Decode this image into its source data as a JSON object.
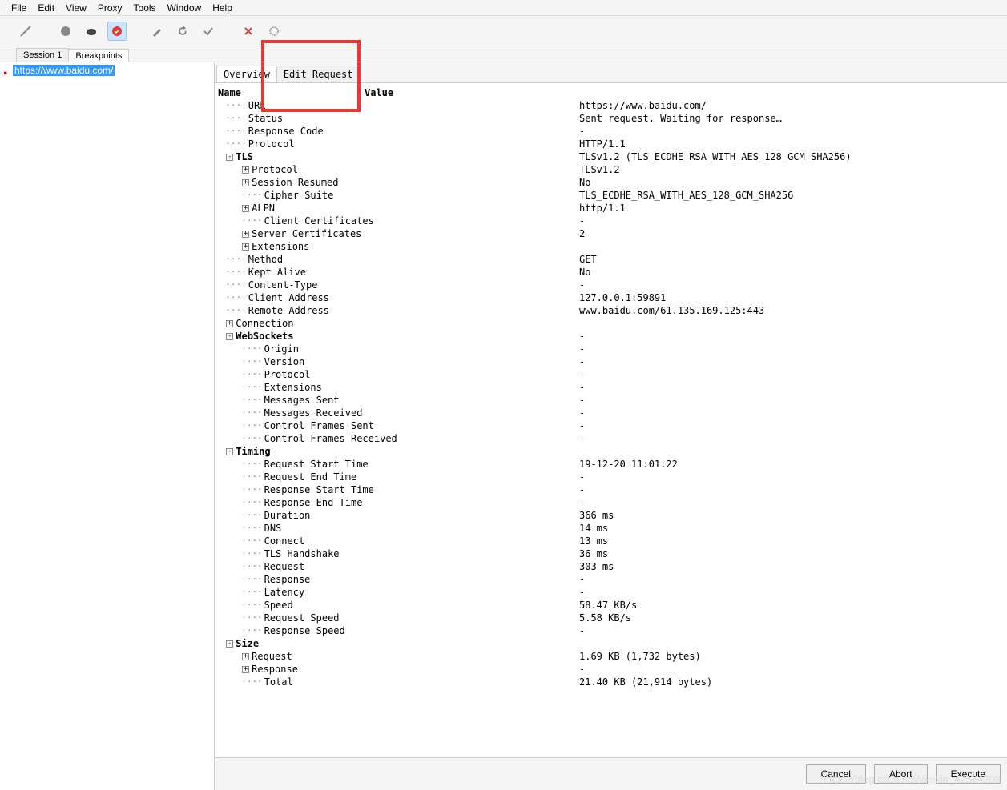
{
  "menu": {
    "file": "File",
    "edit": "Edit",
    "view": "View",
    "proxy": "Proxy",
    "tools": "Tools",
    "window": "Window",
    "help": "Help"
  },
  "sessionTabs": {
    "session1": "Session 1",
    "breakpoints": "Breakpoints"
  },
  "sidebar": {
    "item0": {
      "url": "https://www.baidu.com/"
    }
  },
  "detailTabs": {
    "overview": "Overview",
    "editRequest": "Edit Request"
  },
  "headers": {
    "name": "Name",
    "value": "Value"
  },
  "overview": {
    "url": {
      "label": "URL",
      "value": "https://www.baidu.com/"
    },
    "status": {
      "label": "Status",
      "value": "Sent request. Waiting for response…"
    },
    "responseCode": {
      "label": "Response Code",
      "value": "-"
    },
    "protocol": {
      "label": "Protocol",
      "value": "HTTP/1.1"
    },
    "tls": {
      "label": "TLS",
      "value": "TLSv1.2 (TLS_ECDHE_RSA_WITH_AES_128_GCM_SHA256)",
      "protocol": {
        "label": "Protocol",
        "value": "TLSv1.2"
      },
      "sessionResumed": {
        "label": "Session Resumed",
        "value": "No"
      },
      "cipherSuite": {
        "label": "Cipher Suite",
        "value": "TLS_ECDHE_RSA_WITH_AES_128_GCM_SHA256"
      },
      "alpn": {
        "label": "ALPN",
        "value": "http/1.1"
      },
      "clientCerts": {
        "label": "Client Certificates",
        "value": "-"
      },
      "serverCerts": {
        "label": "Server Certificates",
        "value": "2"
      },
      "extensions": {
        "label": "Extensions",
        "value": ""
      }
    },
    "method": {
      "label": "Method",
      "value": "GET"
    },
    "keptAlive": {
      "label": "Kept Alive",
      "value": "No"
    },
    "contentType": {
      "label": "Content-Type",
      "value": "-"
    },
    "clientAddress": {
      "label": "Client Address",
      "value": "127.0.0.1:59891"
    },
    "remoteAddress": {
      "label": "Remote Address",
      "value": "www.baidu.com/61.135.169.125:443"
    },
    "connection": {
      "label": "Connection",
      "value": ""
    },
    "webSockets": {
      "label": "WebSockets",
      "value": "-",
      "origin": {
        "label": "Origin",
        "value": "-"
      },
      "version": {
        "label": "Version",
        "value": "-"
      },
      "protocol": {
        "label": "Protocol",
        "value": "-"
      },
      "extensions": {
        "label": "Extensions",
        "value": "-"
      },
      "messagesSent": {
        "label": "Messages Sent",
        "value": "-"
      },
      "messagesReceived": {
        "label": "Messages Received",
        "value": "-"
      },
      "ctrlFramesSent": {
        "label": "Control Frames Sent",
        "value": "-"
      },
      "ctrlFramesRecv": {
        "label": "Control Frames Received",
        "value": "-"
      }
    },
    "timing": {
      "label": "Timing",
      "value": "",
      "reqStart": {
        "label": "Request Start Time",
        "value": "19-12-20 11:01:22"
      },
      "reqEnd": {
        "label": "Request End Time",
        "value": "-"
      },
      "respStart": {
        "label": "Response Start Time",
        "value": "-"
      },
      "respEnd": {
        "label": "Response End Time",
        "value": "-"
      },
      "duration": {
        "label": "Duration",
        "value": "366 ms"
      },
      "dns": {
        "label": "DNS",
        "value": "14 ms"
      },
      "connect": {
        "label": "Connect",
        "value": "13 ms"
      },
      "tlsHandshake": {
        "label": "TLS Handshake",
        "value": "36 ms"
      },
      "request": {
        "label": "Request",
        "value": "303 ms"
      },
      "response": {
        "label": "Response",
        "value": "-"
      },
      "latency": {
        "label": "Latency",
        "value": "-"
      },
      "speed": {
        "label": "Speed",
        "value": "58.47 KB/s"
      },
      "reqSpeed": {
        "label": "Request Speed",
        "value": "5.58 KB/s"
      },
      "respSpeed": {
        "label": "Response Speed",
        "value": "-"
      }
    },
    "size": {
      "label": "Size",
      "value": "",
      "request": {
        "label": "Request",
        "value": "1.69 KB (1,732 bytes)"
      },
      "response": {
        "label": "Response",
        "value": "-"
      },
      "total": {
        "label": "Total",
        "value": "21.40 KB (21,914 bytes)"
      }
    }
  },
  "buttons": {
    "cancel": "Cancel",
    "abort": "Abort",
    "execute": "Execute"
  },
  "watermark": "https://blog.csdn.net/weixin_42564208"
}
